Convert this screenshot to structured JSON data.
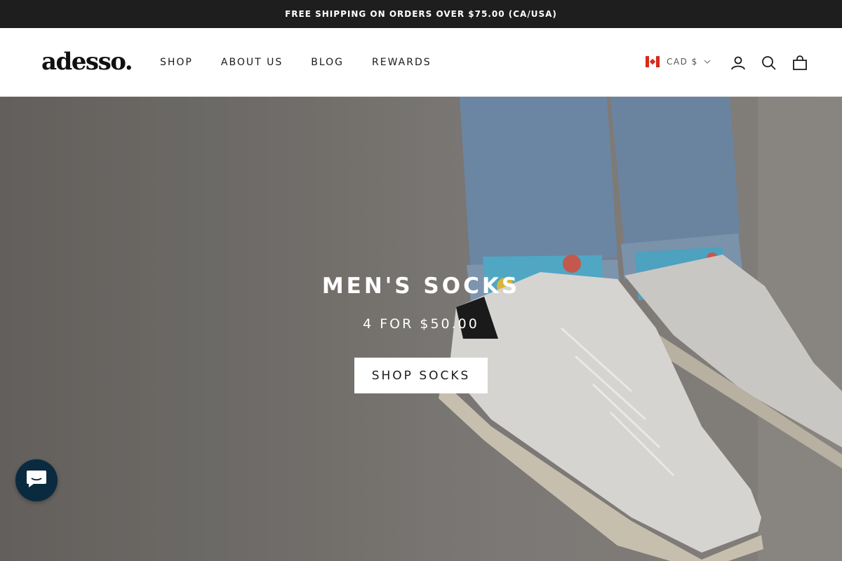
{
  "announcement": {
    "text": "FREE SHIPPING ON ORDERS OVER $75.00 (CA/USA)"
  },
  "header": {
    "logo": "adesso.",
    "nav": [
      "SHOP",
      "ABOUT US",
      "BLOG",
      "REWARDS"
    ],
    "currency": {
      "label": "CAD $",
      "flag": "canada-flag"
    },
    "icons": [
      "account-icon",
      "search-icon",
      "bag-icon"
    ]
  },
  "hero": {
    "title": "MEN'S SOCKS",
    "subtitle": "4 FOR $50.00",
    "button_label": "SHOP SOCKS"
  },
  "chat": {
    "icon": "chat-bubble-icon",
    "color": "#0a2a3f"
  },
  "colors": {
    "topbar": "#1e1e1e",
    "accent": "#0a2a3f"
  }
}
